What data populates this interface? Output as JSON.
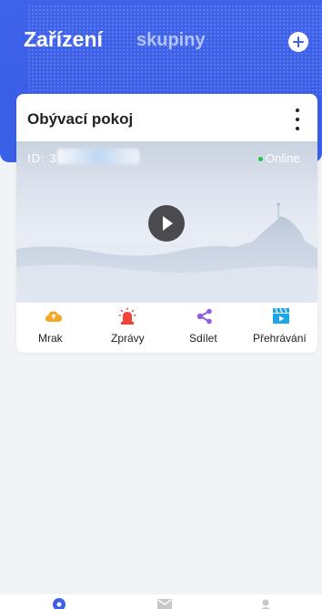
{
  "header": {
    "tabs": [
      {
        "label": "Zařízení",
        "active": true
      },
      {
        "label": "skupiny",
        "active": false
      }
    ],
    "add_icon": "plus-circle-icon"
  },
  "device_card": {
    "name": "Obývací pokoj",
    "id_prefix": "ID: 3",
    "status": "Online",
    "status_color": "#27c24c",
    "more_icon": "more-vertical-icon",
    "play_icon": "play-icon",
    "actions": [
      {
        "label": "Mrak",
        "icon": "cloud-icon",
        "color": "#f5a623"
      },
      {
        "label": "Zprávy",
        "icon": "alarm-siren-icon",
        "color": "#f0433a"
      },
      {
        "label": "Sdílet",
        "icon": "share-icon",
        "color": "#8e5ce6"
      },
      {
        "label": "Přehrávání",
        "icon": "playback-clapperboard-icon",
        "color": "#1ea7e8"
      }
    ]
  },
  "bottom_nav": {
    "items": [
      {
        "icon": "device-icon",
        "color": "#3d61e8"
      },
      {
        "icon": "messages-icon",
        "color": "#c8c8c8"
      },
      {
        "icon": "profile-icon",
        "color": "#c8c8c8"
      }
    ]
  },
  "colors": {
    "accent": "#3d61e8",
    "background": "#f2f3f7"
  }
}
